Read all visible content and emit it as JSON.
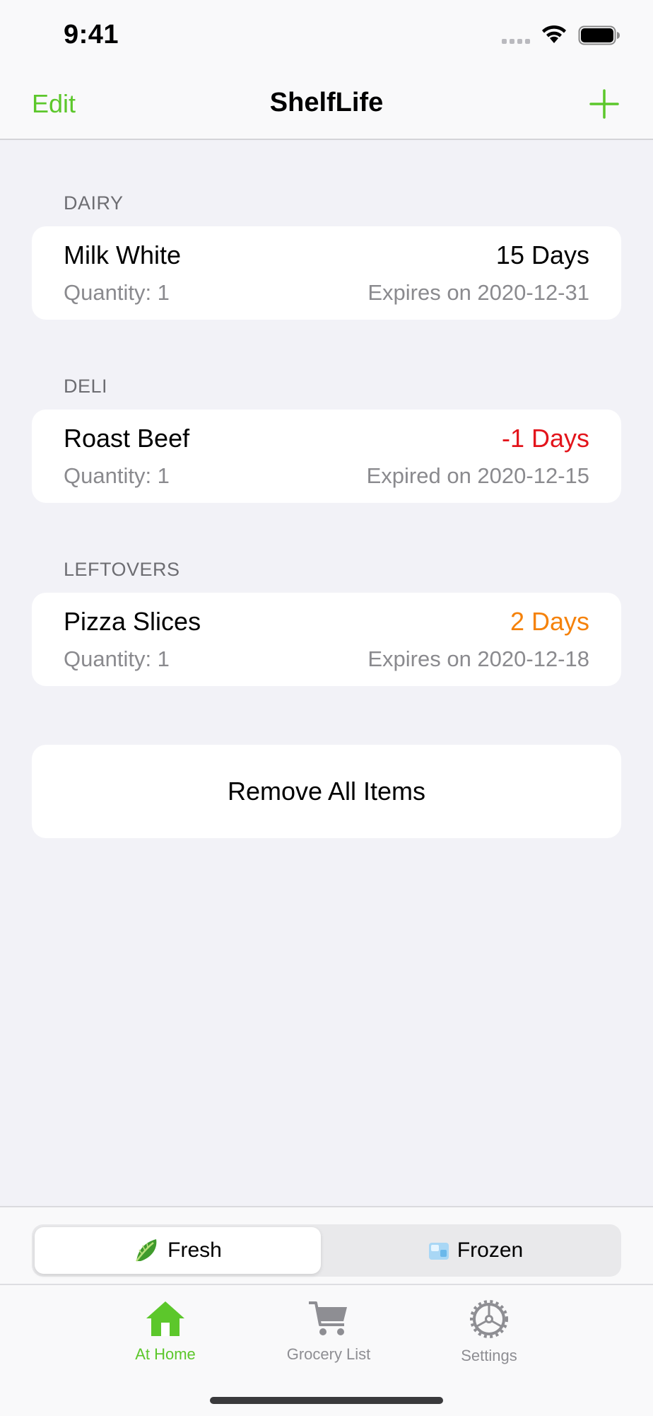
{
  "status_bar": {
    "time": "9:41"
  },
  "nav": {
    "edit_label": "Edit",
    "title": "ShelfLife",
    "add_icon": "plus-icon"
  },
  "sections": [
    {
      "header": "DAIRY",
      "item": {
        "name": "Milk White",
        "quantity": "Quantity: 1",
        "days": "15 Days",
        "expiry": "Expires on 2020-12-31",
        "days_color": "#000000"
      }
    },
    {
      "header": "DELI",
      "item": {
        "name": "Roast Beef",
        "quantity": "Quantity: 1",
        "days": "-1 Days",
        "expiry": "Expired on 2020-12-15",
        "days_color": "#e3141b"
      }
    },
    {
      "header": "LEFTOVERS",
      "item": {
        "name": "Pizza Slices",
        "quantity": "Quantity: 1",
        "days": "2 Days",
        "expiry": "Expires on 2020-12-18",
        "days_color": "#f5820b"
      }
    }
  ],
  "remove_all_label": "Remove All Items",
  "segments": {
    "fresh": {
      "label": "Fresh",
      "icon": "lettuce-icon",
      "selected": true
    },
    "frozen": {
      "label": "Frozen",
      "icon": "ice-cube-icon",
      "selected": false
    }
  },
  "tabs": [
    {
      "label": "At Home",
      "icon": "house-icon",
      "active": true
    },
    {
      "label": "Grocery List",
      "icon": "cart-icon",
      "active": false
    },
    {
      "label": "Settings",
      "icon": "gear-icon",
      "active": false
    }
  ],
  "colors": {
    "accent": "#5cc72b",
    "background": "#f2f2f7",
    "secondary_text": "#8a8a8e",
    "expired": "#e3141b",
    "warning": "#f5820b"
  }
}
